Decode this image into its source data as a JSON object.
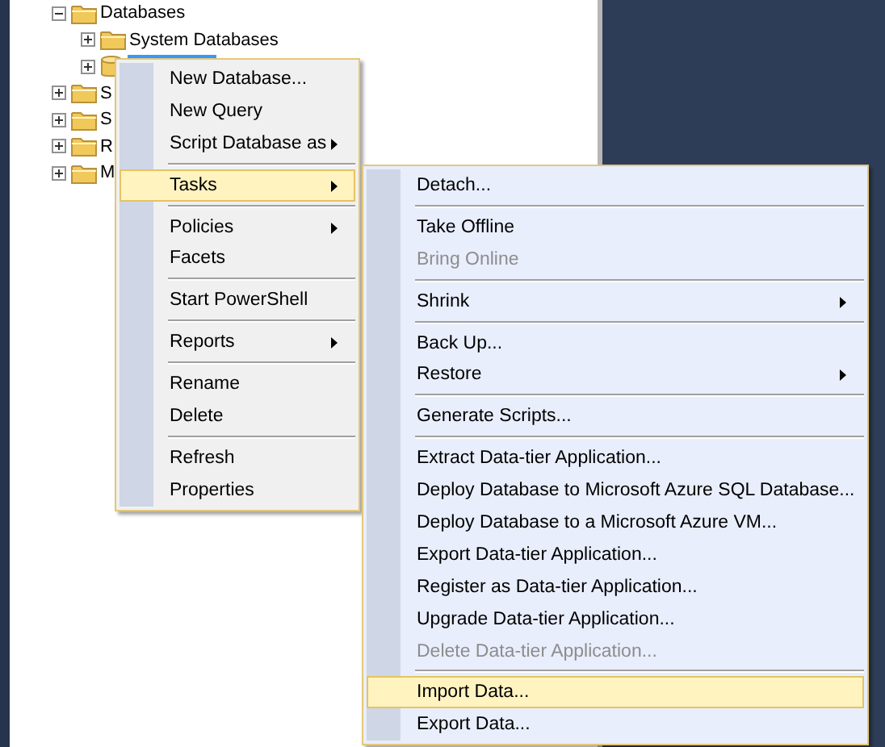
{
  "tree": [
    {
      "label": "Databases",
      "expanded": true,
      "kind": "folder",
      "children": [
        {
          "label": "System Databases",
          "expanded": false,
          "kind": "folder",
          "selected": false
        },
        {
          "expanded": false,
          "kind": "database",
          "selected": true
        }
      ]
    },
    {
      "label": "S",
      "expanded": false,
      "kind": "folder"
    },
    {
      "label": "S",
      "expanded": false,
      "kind": "folder"
    },
    {
      "label": "R",
      "expanded": false,
      "kind": "folder"
    },
    {
      "label": "M",
      "expanded": false,
      "kind": "folder"
    }
  ],
  "context_menu": [
    {
      "kind": "item",
      "label": "New Database...",
      "submenu": false,
      "selected": false,
      "disabled": false
    },
    {
      "kind": "item",
      "label": "New Query",
      "submenu": false,
      "selected": false,
      "disabled": false
    },
    {
      "kind": "item",
      "label": "Script Database as",
      "submenu": true,
      "selected": false,
      "disabled": false
    },
    {
      "kind": "separator"
    },
    {
      "kind": "item",
      "label": "Tasks",
      "submenu": true,
      "selected": true,
      "disabled": false
    },
    {
      "kind": "separator"
    },
    {
      "kind": "item",
      "label": "Policies",
      "submenu": true,
      "selected": false,
      "disabled": false
    },
    {
      "kind": "item",
      "label": "Facets",
      "submenu": false,
      "selected": false,
      "disabled": false
    },
    {
      "kind": "separator"
    },
    {
      "kind": "item",
      "label": "Start PowerShell",
      "submenu": false,
      "selected": false,
      "disabled": false
    },
    {
      "kind": "separator"
    },
    {
      "kind": "item",
      "label": "Reports",
      "submenu": true,
      "selected": false,
      "disabled": false
    },
    {
      "kind": "separator"
    },
    {
      "kind": "item",
      "label": "Rename",
      "submenu": false,
      "selected": false,
      "disabled": false
    },
    {
      "kind": "item",
      "label": "Delete",
      "submenu": false,
      "selected": false,
      "disabled": false
    },
    {
      "kind": "separator"
    },
    {
      "kind": "item",
      "label": "Refresh",
      "submenu": false,
      "selected": false,
      "disabled": false
    },
    {
      "kind": "item",
      "label": "Properties",
      "submenu": false,
      "selected": false,
      "disabled": false
    }
  ],
  "tasks_submenu": [
    {
      "kind": "item",
      "label": "Detach...",
      "submenu": false,
      "selected": false,
      "disabled": false
    },
    {
      "kind": "separator"
    },
    {
      "kind": "item",
      "label": "Take Offline",
      "submenu": false,
      "selected": false,
      "disabled": false
    },
    {
      "kind": "item",
      "label": "Bring Online",
      "submenu": false,
      "selected": false,
      "disabled": true
    },
    {
      "kind": "separator"
    },
    {
      "kind": "item",
      "label": "Shrink",
      "submenu": true,
      "selected": false,
      "disabled": false
    },
    {
      "kind": "separator"
    },
    {
      "kind": "item",
      "label": "Back Up...",
      "submenu": false,
      "selected": false,
      "disabled": false
    },
    {
      "kind": "item",
      "label": "Restore",
      "submenu": true,
      "selected": false,
      "disabled": false
    },
    {
      "kind": "separator"
    },
    {
      "kind": "item",
      "label": "Generate Scripts...",
      "submenu": false,
      "selected": false,
      "disabled": false
    },
    {
      "kind": "separator"
    },
    {
      "kind": "item",
      "label": "Extract Data-tier Application...",
      "submenu": false,
      "selected": false,
      "disabled": false
    },
    {
      "kind": "item",
      "label": "Deploy Database to Microsoft Azure SQL Database...",
      "submenu": false,
      "selected": false,
      "disabled": false
    },
    {
      "kind": "item",
      "label": "Deploy Database to a Microsoft Azure VM...",
      "submenu": false,
      "selected": false,
      "disabled": false
    },
    {
      "kind": "item",
      "label": "Export Data-tier Application...",
      "submenu": false,
      "selected": false,
      "disabled": false
    },
    {
      "kind": "item",
      "label": "Register as Data-tier Application...",
      "submenu": false,
      "selected": false,
      "disabled": false
    },
    {
      "kind": "item",
      "label": "Upgrade Data-tier Application...",
      "submenu": false,
      "selected": false,
      "disabled": false
    },
    {
      "kind": "item",
      "label": "Delete Data-tier Application...",
      "submenu": false,
      "selected": false,
      "disabled": true
    },
    {
      "kind": "separator"
    },
    {
      "kind": "item",
      "label": "Import Data...",
      "submenu": false,
      "selected": true,
      "disabled": false
    },
    {
      "kind": "item",
      "label": "Export Data...",
      "submenu": false,
      "selected": false,
      "disabled": false
    }
  ]
}
